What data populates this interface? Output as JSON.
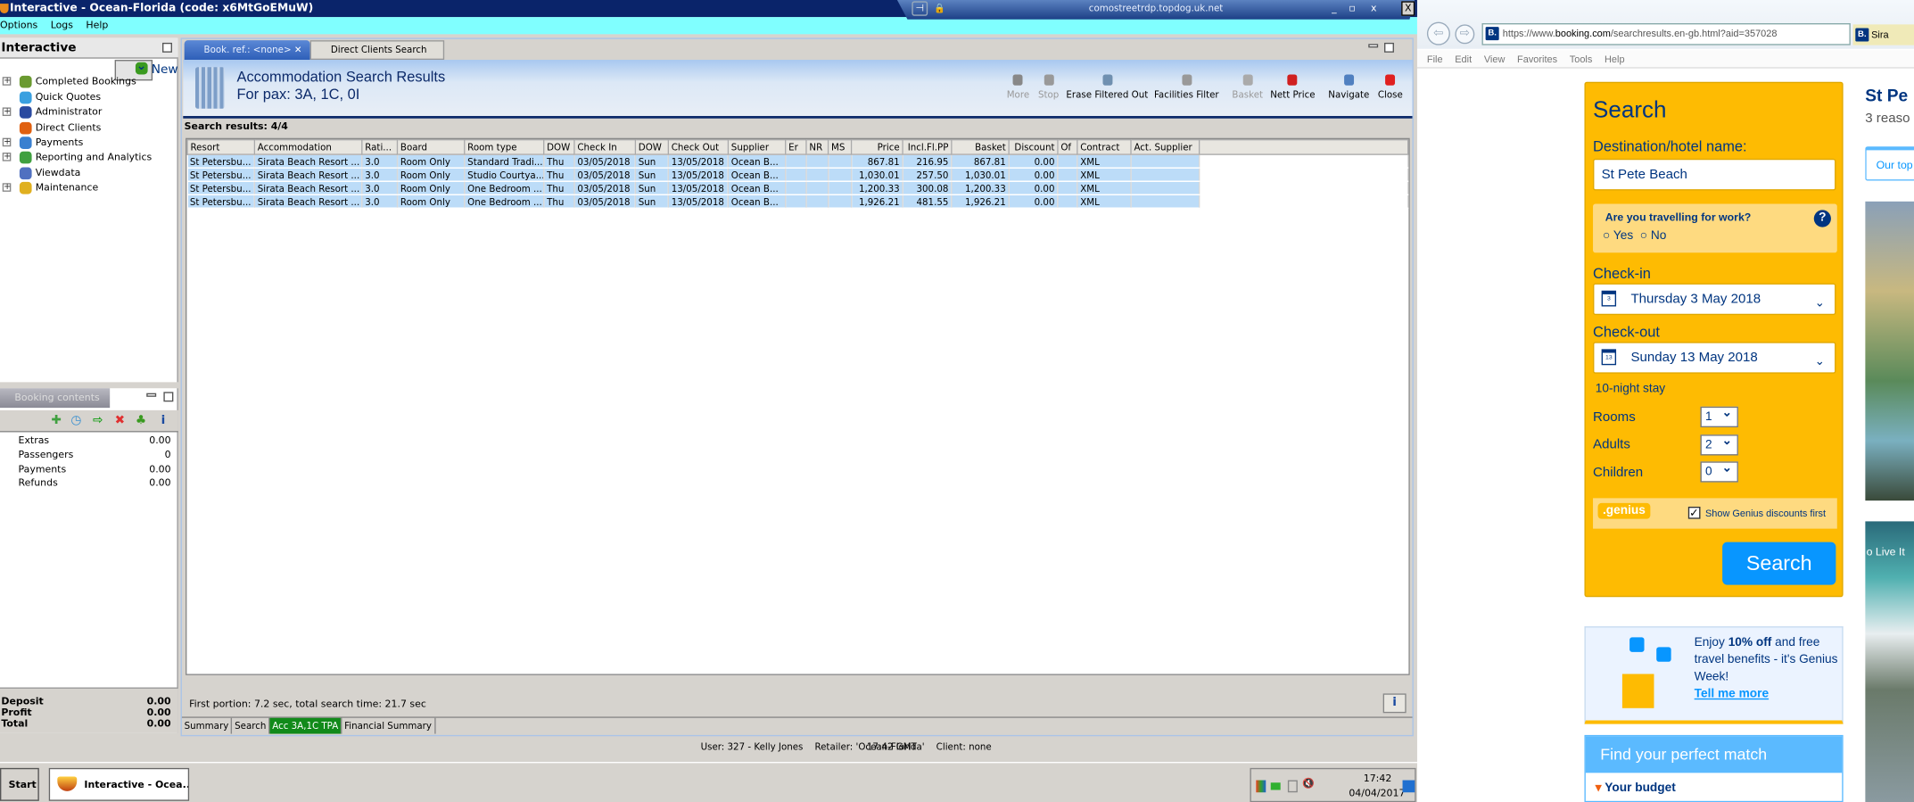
{
  "window": {
    "title": "Interactive - Ocean-Florida (code: x6MtGoEMuW)",
    "menu": [
      "Options",
      "Logs",
      "Help"
    ],
    "rdp_host": "comostreetrdp.topdog.uk.net",
    "close": "X"
  },
  "nav": {
    "title": "Interactive",
    "items": [
      {
        "label": "New Booking",
        "expandable": false,
        "color": "#3a9a20"
      },
      {
        "label": "Completed Bookings",
        "expandable": true,
        "color": "#6a9a30"
      },
      {
        "label": "Quick Quotes",
        "expandable": false,
        "color": "#3aa0e0"
      },
      {
        "label": "Administrator",
        "expandable": true,
        "color": "#2a4aa0"
      },
      {
        "label": "Direct Clients",
        "expandable": false,
        "color": "#e06010"
      },
      {
        "label": "Payments",
        "expandable": true,
        "color": "#3a80d0"
      },
      {
        "label": "Reporting and Analytics",
        "expandable": true,
        "color": "#40a040"
      },
      {
        "label": "Viewdata",
        "expandable": false,
        "color": "#5070c0"
      },
      {
        "label": "Maintenance",
        "expandable": true,
        "color": "#e0b020"
      }
    ]
  },
  "booking_contents": {
    "title": "Booking contents",
    "rows": [
      {
        "label": "Extras",
        "value": "0.00"
      },
      {
        "label": "Passengers",
        "value": "0"
      },
      {
        "label": "Payments",
        "value": "0.00"
      },
      {
        "label": "Refunds",
        "value": "0.00"
      }
    ],
    "totals": [
      {
        "label": "Deposit",
        "value": "0.00"
      },
      {
        "label": "Profit",
        "value": "0.00"
      },
      {
        "label": "Total",
        "value": "0.00"
      }
    ],
    "info": "i"
  },
  "tabs": [
    {
      "label": "Book. ref.: <none>",
      "close": "✕"
    },
    {
      "label": "Direct Clients Search"
    }
  ],
  "header": {
    "title": "Accommodation Search Results",
    "subtitle": "For pax: 3A, 1C, 0I"
  },
  "toolbar": [
    {
      "label": "More",
      "enabled": false,
      "color": "#888"
    },
    {
      "label": "Stop",
      "enabled": false,
      "color": "#999"
    },
    {
      "label": "Erase Filtered Out",
      "enabled": true,
      "color": "#7090b0"
    },
    {
      "label": "Facilities Filter",
      "enabled": true,
      "color": "#999"
    },
    {
      "label": "Basket",
      "enabled": false,
      "color": "#aaa"
    },
    {
      "label": "Nett Price",
      "enabled": true,
      "color": "#d02020"
    },
    {
      "label": "Navigate",
      "enabled": true,
      "color": "#5080c0"
    },
    {
      "label": "Close",
      "enabled": true,
      "color": "#e02020"
    }
  ],
  "results": {
    "count_label": "Search results: 4/4",
    "columns": [
      "Resort",
      "Accommodation",
      "Rati...",
      "Board",
      "Room type",
      "DOW",
      "Check In",
      "DOW",
      "Check Out",
      "Supplier",
      "Er",
      "NR",
      "MS",
      "Price",
      "Incl.Fl.PP",
      "Basket",
      "Discount",
      "Of",
      "Contract",
      "Act. Supplier"
    ],
    "rows": [
      [
        "St Petersbu...",
        "Sirata Beach Resort ...",
        "3.0",
        "Room Only",
        "Standard Tradi...",
        "Thu",
        "03/05/2018",
        "Sun",
        "13/05/2018",
        "Ocean B...",
        "",
        "",
        "",
        "867.81",
        "216.95",
        "867.81",
        "0.00",
        "",
        "XML",
        ""
      ],
      [
        "St Petersbu...",
        "Sirata Beach Resort ...",
        "3.0",
        "Room Only",
        "Studio Courtya...",
        "Thu",
        "03/05/2018",
        "Sun",
        "13/05/2018",
        "Ocean B...",
        "",
        "",
        "",
        "1,030.01",
        "257.50",
        "1,030.01",
        "0.00",
        "",
        "XML",
        ""
      ],
      [
        "St Petersbu...",
        "Sirata Beach Resort ...",
        "3.0",
        "Room Only",
        "One Bedroom ...",
        "Thu",
        "03/05/2018",
        "Sun",
        "13/05/2018",
        "Ocean B...",
        "",
        "",
        "",
        "1,200.33",
        "300.08",
        "1,200.33",
        "0.00",
        "",
        "XML",
        ""
      ],
      [
        "St Petersbu...",
        "Sirata Beach Resort ...",
        "3.0",
        "Room Only",
        "One Bedroom ...",
        "Thu",
        "03/05/2018",
        "Sun",
        "13/05/2018",
        "Ocean B...",
        "",
        "",
        "",
        "1,926.21",
        "481.55",
        "1,926.21",
        "0.00",
        "",
        "XML",
        ""
      ]
    ],
    "footer": "First portion: 7.2 sec, total search time: 21.7 sec",
    "info": "i"
  },
  "bottom_tabs": [
    {
      "label": "Summary"
    },
    {
      "label": "Search"
    },
    {
      "label": "Acc 3A,1C TPA",
      "active": true
    },
    {
      "label": "Financial Summary"
    }
  ],
  "status": {
    "text": "User: 327 - Kelly Jones    Retailer: 'Ocean-Florida'    Client: none",
    "time": "17:42 GMT"
  },
  "taskbar": {
    "start": "Start",
    "task": "Interactive - Ocea...",
    "clock": "17:42",
    "date": "04/04/2017"
  },
  "browser": {
    "url_pre": "https://www.",
    "url_domain": "booking.com",
    "url_post": "/searchresults.en-gb.html?aid=357028",
    "tab": "Sira",
    "favicon": "B.",
    "menu": [
      "File",
      "Edit",
      "View",
      "Favorites",
      "Tools",
      "Help"
    ],
    "search": {
      "title": "Search",
      "dest_label": "Destination/hotel name:",
      "dest_value": "St Pete Beach",
      "work_q": "Are you travelling for work?",
      "yes": "Yes",
      "no": "No",
      "checkin_label": "Check-in",
      "checkin_value": "Thursday 3 May 2018",
      "checkin_day": "3",
      "checkout_label": "Check-out",
      "checkout_value": "Sunday 13 May 2018",
      "checkout_day": "13",
      "stay": "10-night stay",
      "rooms_label": "Rooms",
      "rooms": "1",
      "adults_label": "Adults",
      "adults": "2",
      "children_label": "Children",
      "children": "0",
      "genius_badge": ".genius",
      "genius_label": "Show Genius discounts first",
      "button": "Search"
    },
    "promo": {
      "pre": "Enjoy ",
      "bold": "10% off",
      "post": " and free travel benefits - it's Genius Week!",
      "link": "Tell me more"
    },
    "match": {
      "title": "Find your perfect match",
      "budget": "Your budget"
    },
    "right": {
      "heading": "St Pe",
      "sub": "3 reaso",
      "top": "Our top",
      "banner": "o Live It"
    }
  },
  "colors": {
    "accent": "#0a246a",
    "booking_yellow": "#febb02",
    "booking_blue": "#003580",
    "active_tab": "#118a1a"
  }
}
